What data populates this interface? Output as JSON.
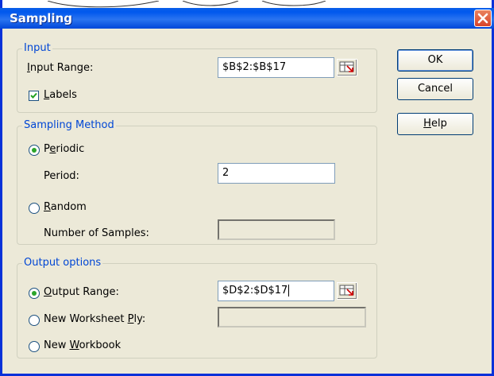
{
  "window": {
    "title": "Sampling"
  },
  "input_group": {
    "legend": "Input",
    "range_label_pre": "",
    "range_label_ul": "I",
    "range_label_post": "nput Range:",
    "range_value": "$B$2:$B$17",
    "labels_checked": true,
    "labels_ul": "L",
    "labels_post": "abels"
  },
  "method_group": {
    "legend": "Sampling Method",
    "periodic_pre": "P",
    "periodic_ul": "e",
    "periodic_post": "riodic",
    "period_label": "Period:",
    "period_value": "2",
    "random_ul": "R",
    "random_post": "andom",
    "samples_label": "Number of Samples:",
    "samples_value": "",
    "selected": "periodic"
  },
  "output_group": {
    "legend": "Output options",
    "range_ul": "O",
    "range_post": "utput Range:",
    "range_value": "$D$2:$D$17",
    "ply_pre": "New Worksheet ",
    "ply_ul": "P",
    "ply_post": "ly:",
    "ply_value": "",
    "wb_pre": "New ",
    "wb_ul": "W",
    "wb_post": "orkbook",
    "selected": "output-range"
  },
  "buttons": {
    "ok": "OK",
    "cancel": "Cancel",
    "help_ul": "H",
    "help_post": "elp"
  },
  "colors": {
    "title_bar": "#0058ee",
    "legend": "#0046d5",
    "dialog_bg": "#ece9d8",
    "radio_dot": "#2ba52b"
  },
  "icons": {
    "close": "close-icon",
    "range_select": "range-select-icon",
    "check": "checkmark-icon"
  }
}
